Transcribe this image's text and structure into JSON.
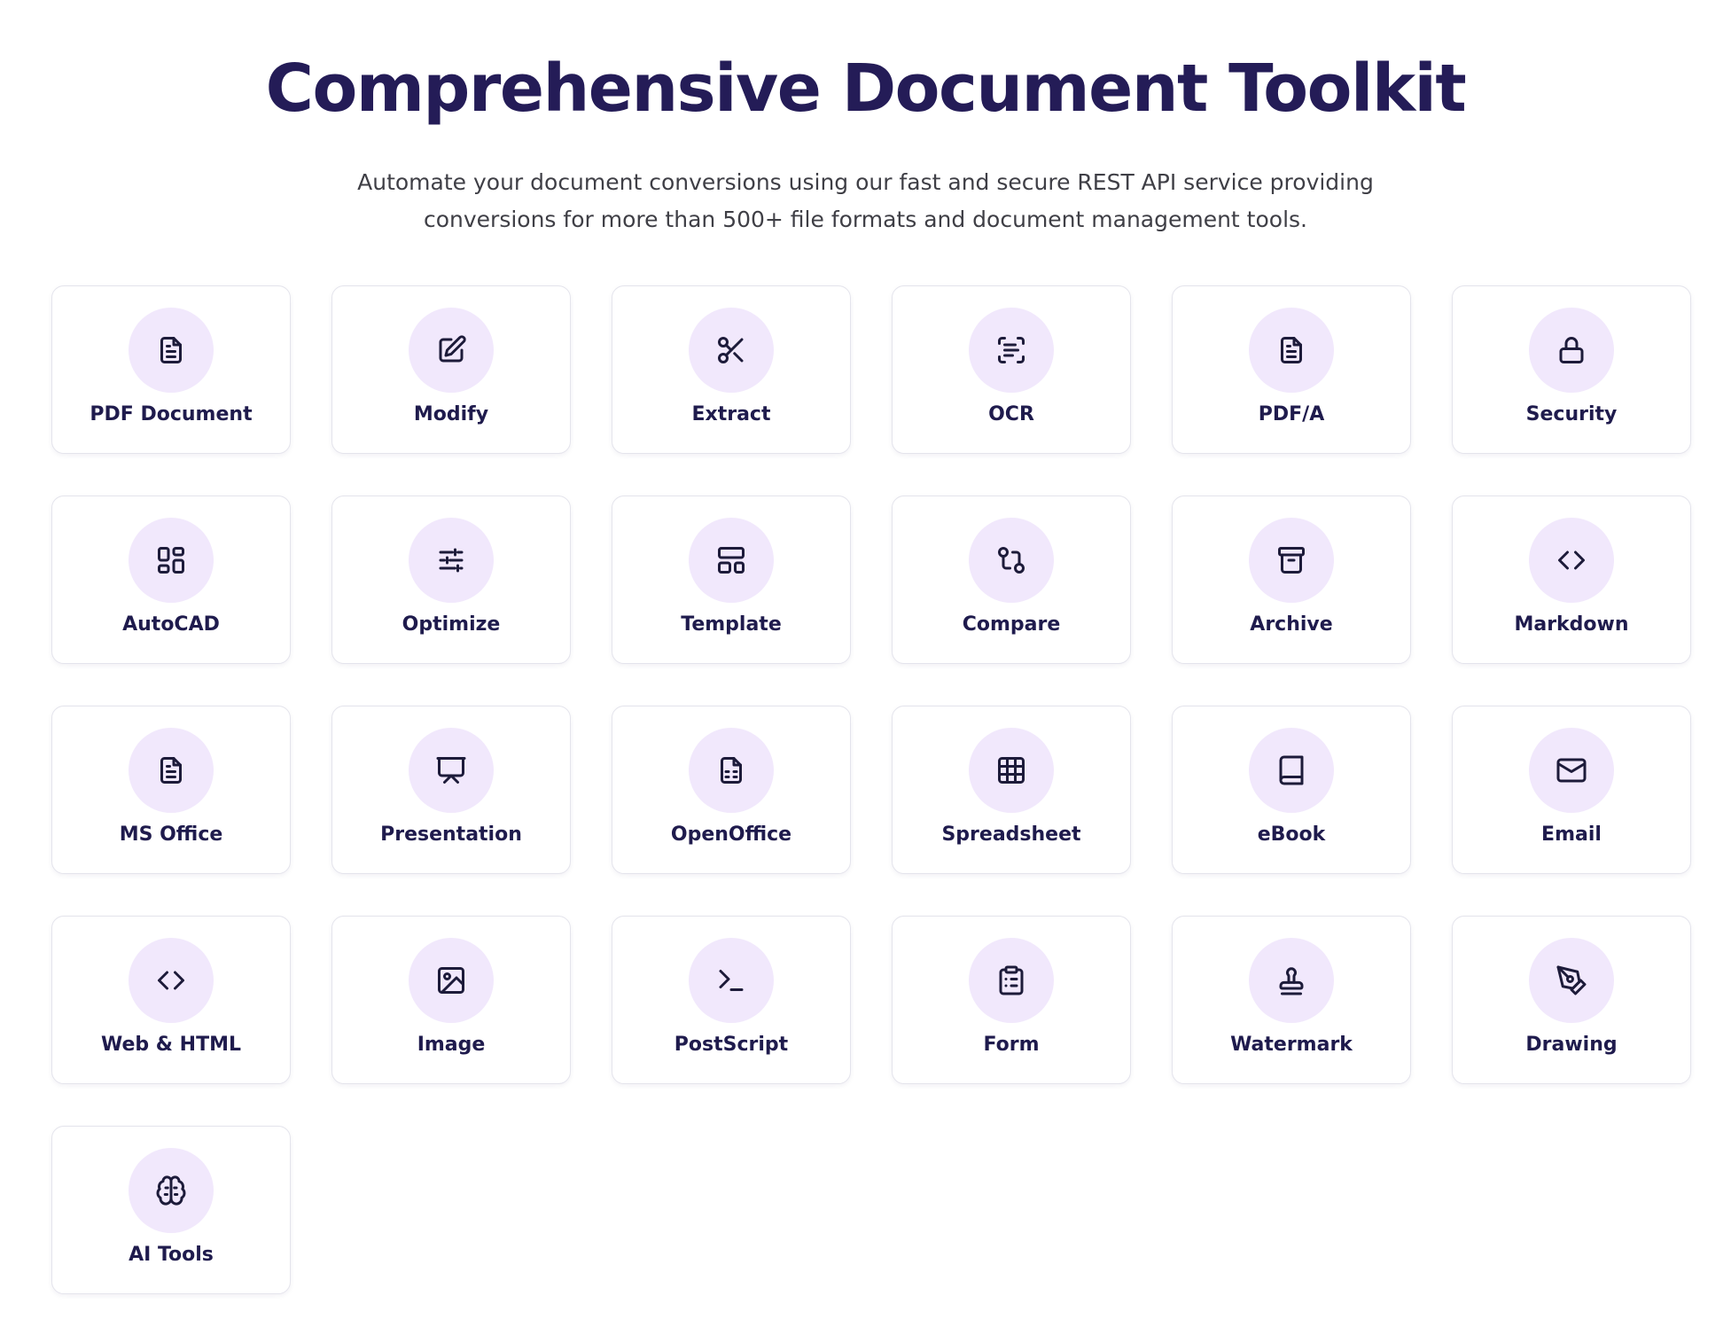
{
  "header": {
    "title": "Comprehensive Document Toolkit",
    "subtitle_line1": "Automate your document conversions using our fast and secure REST API service providing",
    "subtitle_line2": "conversions for more than 500+ file formats and document management tools."
  },
  "colors": {
    "title": "#241c57",
    "icon_bg": "#f1e8fc",
    "card_border": "#e4e4ec"
  },
  "tools": [
    {
      "label": "PDF Document",
      "icon": "file-text-icon"
    },
    {
      "label": "Modify",
      "icon": "edit-icon"
    },
    {
      "label": "Extract",
      "icon": "scissors-icon"
    },
    {
      "label": "OCR",
      "icon": "scan-text-icon"
    },
    {
      "label": "PDF/A",
      "icon": "file-text-icon"
    },
    {
      "label": "Security",
      "icon": "lock-icon"
    },
    {
      "label": "AutoCAD",
      "icon": "layout-icon"
    },
    {
      "label": "Optimize",
      "icon": "sliders-icon"
    },
    {
      "label": "Template",
      "icon": "template-icon"
    },
    {
      "label": "Compare",
      "icon": "git-compare-icon"
    },
    {
      "label": "Archive",
      "icon": "archive-icon"
    },
    {
      "label": "Markdown",
      "icon": "code-icon"
    },
    {
      "label": "MS Office",
      "icon": "file-text-icon"
    },
    {
      "label": "Presentation",
      "icon": "presentation-icon"
    },
    {
      "label": "OpenOffice",
      "icon": "file-spreadsheet-icon"
    },
    {
      "label": "Spreadsheet",
      "icon": "table-icon"
    },
    {
      "label": "eBook",
      "icon": "book-icon"
    },
    {
      "label": "Email",
      "icon": "mail-icon"
    },
    {
      "label": "Web & HTML",
      "icon": "code-icon"
    },
    {
      "label": "Image",
      "icon": "image-icon"
    },
    {
      "label": "PostScript",
      "icon": "terminal-icon"
    },
    {
      "label": "Form",
      "icon": "clipboard-list-icon"
    },
    {
      "label": "Watermark",
      "icon": "stamp-icon"
    },
    {
      "label": "Drawing",
      "icon": "pen-tool-icon"
    },
    {
      "label": "AI Tools",
      "icon": "brain-icon"
    }
  ]
}
